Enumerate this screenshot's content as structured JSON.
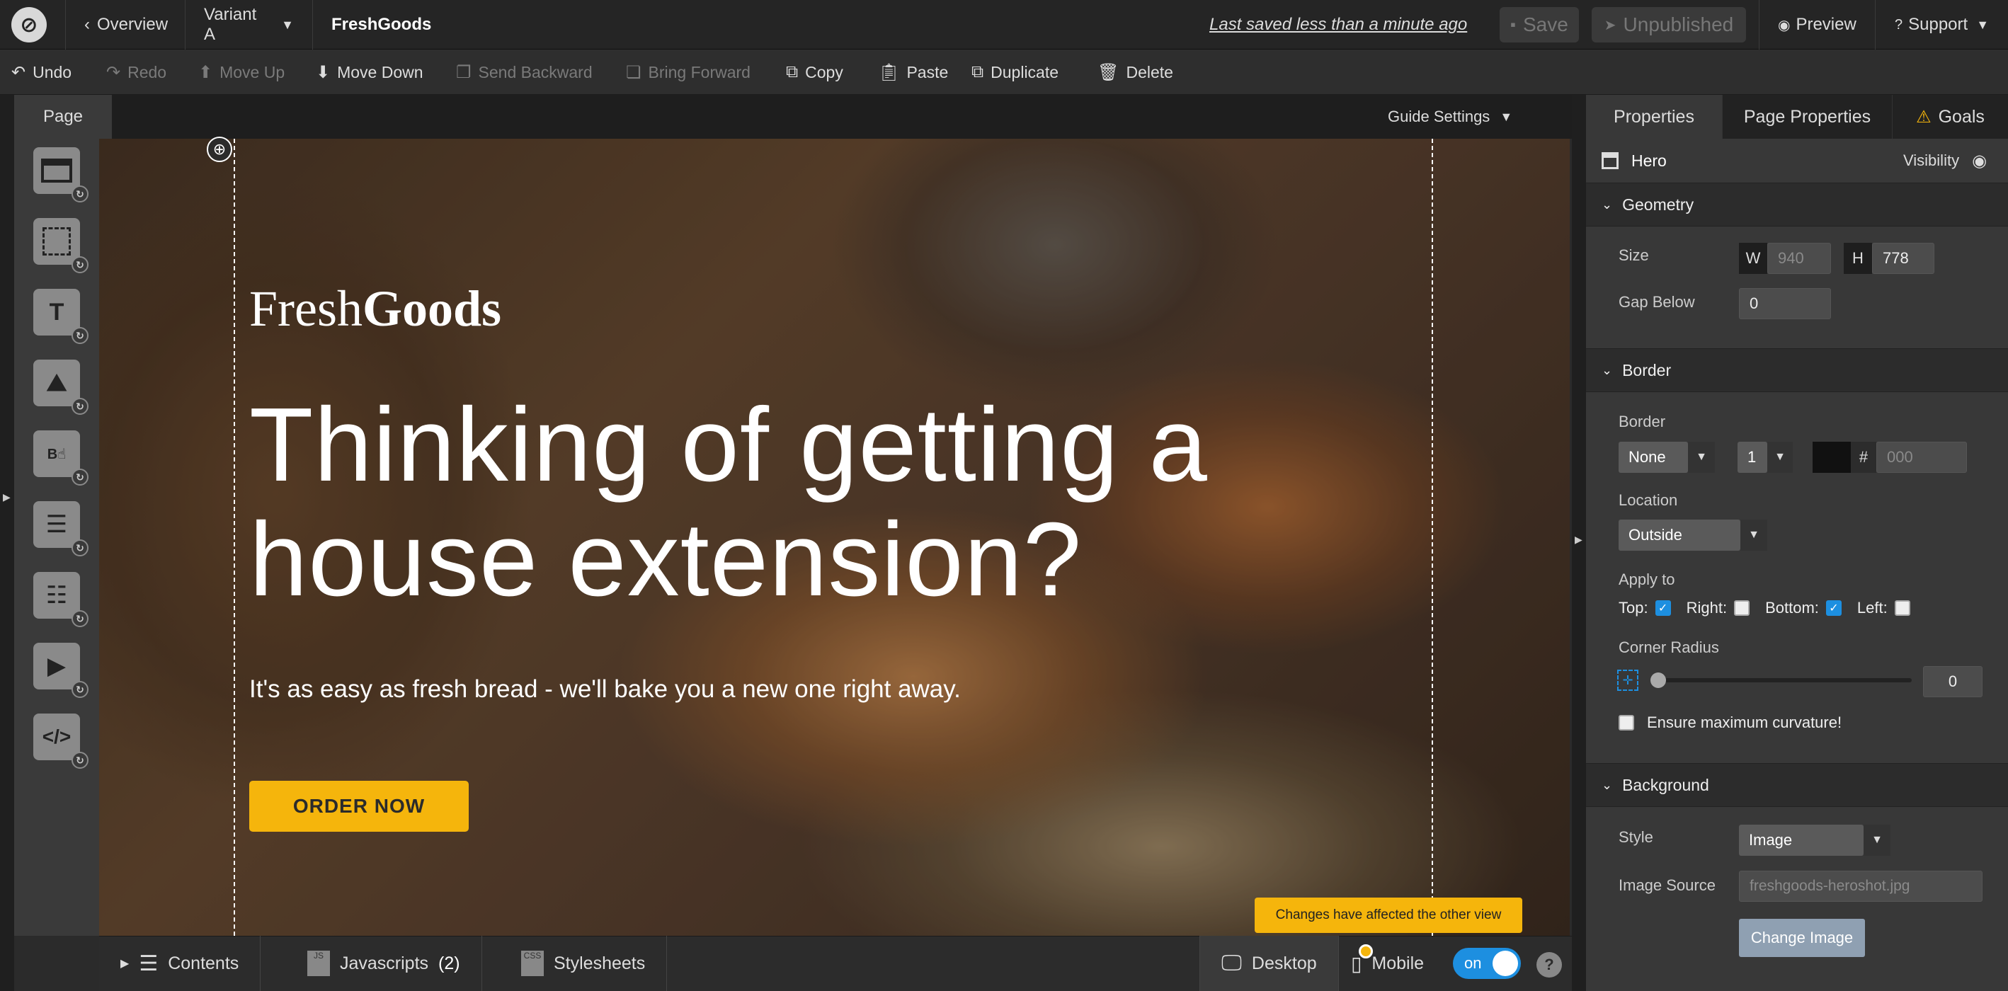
{
  "topbar": {
    "overview_label": "Overview",
    "variant_label": "Variant A",
    "page_name": "FreshGoods",
    "last_saved": "Last saved  less than a minute ago",
    "save_label": "Save",
    "unpublished_label": "Unpublished",
    "preview_label": "Preview",
    "support_label": "Support"
  },
  "toolbar": {
    "undo": "Undo",
    "redo": "Redo",
    "move_up": "Move Up",
    "move_down": "Move Down",
    "send_backward": "Send Backward",
    "bring_forward": "Bring Forward",
    "copy": "Copy",
    "paste": "Paste",
    "duplicate": "Duplicate",
    "delete": "Delete"
  },
  "canvas": {
    "page_tab": "Page",
    "guide_settings": "Guide Settings"
  },
  "hero": {
    "brand_light": "Fresh",
    "brand_bold": "Goods",
    "headline": "Thinking of getting a house extension?",
    "subline": "It's as easy as fresh bread - we'll bake you a new one right away.",
    "cta": "ORDER NOW"
  },
  "bottombar": {
    "contents": "Contents",
    "javascripts": "Javascripts",
    "javascripts_count": "(2)",
    "stylesheets": "Stylesheets",
    "desktop": "Desktop",
    "mobile": "Mobile",
    "toggle_state": "on",
    "tooltip": "Changes have affected the other view",
    "help": "?"
  },
  "panel": {
    "tabs": [
      "Properties",
      "Page Properties",
      "Goals"
    ],
    "element_name": "Hero",
    "visibility": "Visibility",
    "geometry": {
      "title": "Geometry",
      "size_label": "Size",
      "w_prefix": "W",
      "w_value": "940",
      "h_prefix": "H",
      "h_value": "778",
      "gap_label": "Gap Below",
      "gap_value": "0"
    },
    "border": {
      "title": "Border",
      "border_label": "Border",
      "style_value": "None",
      "width_value": "1",
      "hash": "#",
      "color_placeholder": "000",
      "location_label": "Location",
      "location_value": "Outside",
      "apply_label": "Apply to",
      "top": "Top:",
      "right": "Right:",
      "bottom": "Bottom:",
      "left": "Left:",
      "top_checked": true,
      "right_checked": false,
      "bottom_checked": true,
      "left_checked": false,
      "corner_label": "Corner Radius",
      "corner_value": "0",
      "ensure_label": "Ensure maximum curvature!"
    },
    "background": {
      "title": "Background",
      "style_label": "Style",
      "style_value": "Image",
      "source_label": "Image Source",
      "source_value": "freshgoods-heroshot.jpg",
      "change_button": "Change Image"
    }
  },
  "colors": {
    "accent": "#1d8fe0",
    "cta": "#f5b50c",
    "warning": "#f5b50c"
  }
}
